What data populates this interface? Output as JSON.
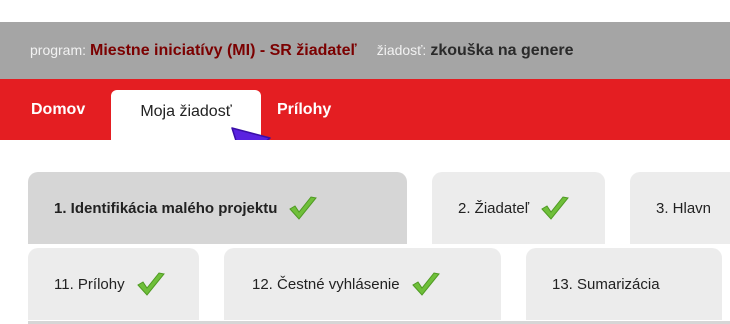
{
  "info": {
    "program_label": "program:",
    "program_value": "Miestne iniciatívy (MI) - SR žiadateľ",
    "request_label": "žiadosť:",
    "request_value": "zkouška na genere"
  },
  "nav": {
    "items": [
      {
        "label": "Domov"
      },
      {
        "label": "Moja žiadosť"
      },
      {
        "label": "Prílohy"
      }
    ]
  },
  "steps": [
    {
      "label": "1. Identifikácia malého projektu",
      "done": true,
      "active": true
    },
    {
      "label": "2. Žiadateľ",
      "done": true,
      "active": false
    },
    {
      "label": "3. Hlavn",
      "done": false,
      "active": false
    },
    {
      "label": "11. Prílohy",
      "done": true,
      "active": false
    },
    {
      "label": "12. Čestné vyhlásenie",
      "done": true,
      "active": false
    },
    {
      "label": "13. Sumarizácia",
      "done": false,
      "active": false
    }
  ],
  "colors": {
    "nav_red": "#e41e22",
    "info_gray": "#a5a5a5",
    "check_green": "#6fbf3a",
    "cursor_blue": "#5a22e0"
  }
}
